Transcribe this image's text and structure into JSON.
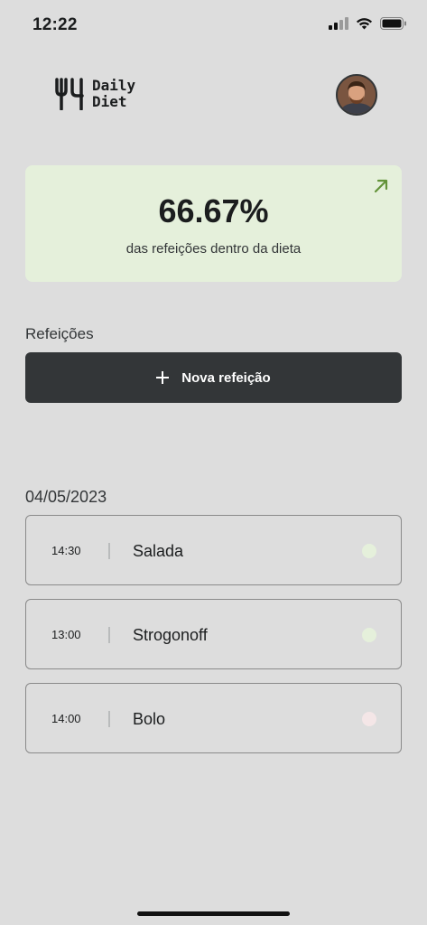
{
  "status_bar": {
    "time": "12:22"
  },
  "logo": {
    "line1": "Daily",
    "line2": "Diet"
  },
  "stats": {
    "percent": "66.67%",
    "caption": "das refeições dentro da dieta",
    "accent_color": "#639339"
  },
  "meals_section": {
    "label": "Refeições",
    "new_button_label": "Nova refeição"
  },
  "date_group": {
    "date": "04/05/2023",
    "meals": [
      {
        "time": "14:30",
        "name": "Salada",
        "status": "in-diet",
        "status_color": "#e5f0db"
      },
      {
        "time": "13:00",
        "name": "Strogonoff",
        "status": "in-diet",
        "status_color": "#e5f0db"
      },
      {
        "time": "14:00",
        "name": "Bolo",
        "status": "off-diet",
        "status_color": "#f4e6e7"
      }
    ]
  }
}
